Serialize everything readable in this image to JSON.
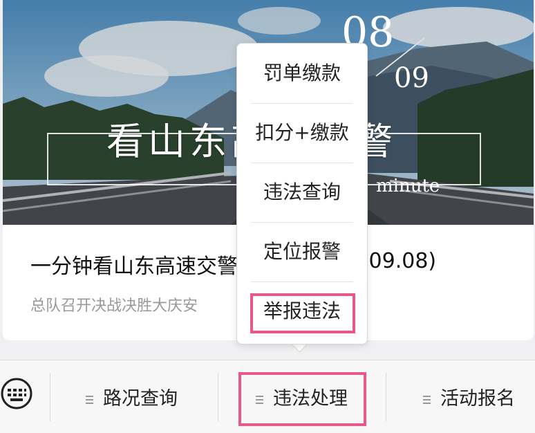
{
  "hero": {
    "title": "看山东高速交警",
    "date_day": "08",
    "date_month": "09",
    "subtitle": "minute"
  },
  "article": {
    "title": "一分钟看山东高速交警",
    "title_end": ".09.08)",
    "description": "总队召开决战决胜大庆安"
  },
  "popup_menu": {
    "items": [
      {
        "label": "罚单缴款"
      },
      {
        "label": "扣分+缴款"
      },
      {
        "label": "违法查询"
      },
      {
        "label": "定位报警"
      },
      {
        "label": "举报违法",
        "highlighted": true
      }
    ]
  },
  "tabbar": {
    "keyboard_icon": "keyboard-icon",
    "tabs": [
      {
        "label": "路况查询"
      },
      {
        "label": "违法处理",
        "highlighted": true
      },
      {
        "label": "活动报名"
      }
    ]
  },
  "colors": {
    "highlight": "#e8588d",
    "menu_text": "#222222",
    "desc_text": "#999999"
  }
}
